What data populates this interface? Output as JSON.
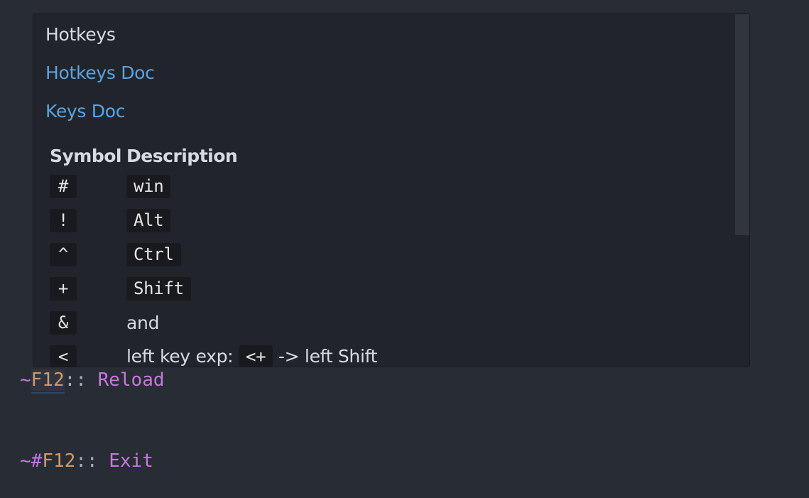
{
  "popup": {
    "title": "Hotkeys",
    "links": [
      "Hotkeys Doc",
      "Keys Doc"
    ],
    "table": {
      "headers": [
        "Symbol",
        "Description"
      ],
      "rows": [
        {
          "symbol": "#",
          "desc": "win",
          "desc_is_code": true
        },
        {
          "symbol": "!",
          "desc": "Alt",
          "desc_is_code": true
        },
        {
          "symbol": "^",
          "desc": "Ctrl",
          "desc_is_code": true
        },
        {
          "symbol": "+",
          "desc": "Shift",
          "desc_is_code": true
        },
        {
          "symbol": "&",
          "desc": "and",
          "desc_is_code": false
        },
        {
          "symbol": "<",
          "desc_prefix": "left key exp:",
          "desc_code": "<+",
          "desc_suffix": "-> left Shift"
        }
      ]
    }
  },
  "code_lines": [
    {
      "prefix": "~",
      "key": "F12",
      "sep": "::",
      "action": "Reload"
    },
    {
      "prefix": "~#",
      "key": "F12",
      "sep": "::",
      "action": "Exit"
    }
  ],
  "colors": {
    "background": "#282c34",
    "popup_background": "#21252b",
    "link": "#5ba3e0",
    "keyword": "#c678dd",
    "key": "#d19a66"
  }
}
